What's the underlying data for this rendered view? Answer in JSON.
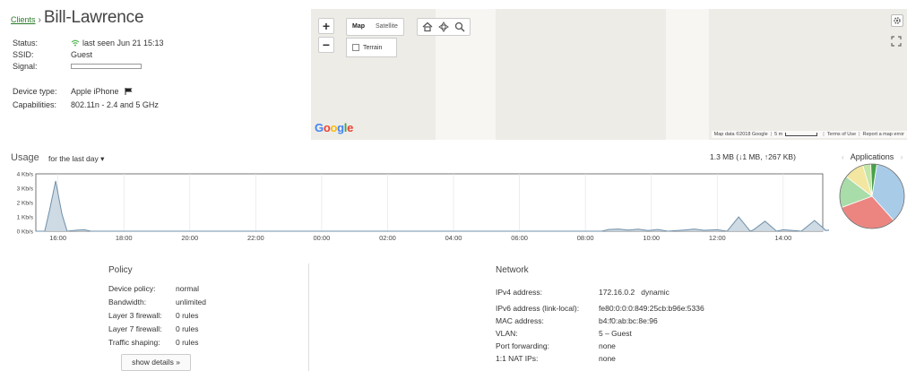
{
  "header": {
    "breadcrumb_link": "Clients",
    "breadcrumb_sep": "›",
    "client_name": "Bill-Lawrence"
  },
  "client": {
    "status_label": "Status:",
    "status_value": "last seen Jun 21 15:13",
    "ssid_label": "SSID:",
    "ssid_value": "Guest",
    "signal_label": "Signal:",
    "device_type_label": "Device type:",
    "device_type_value": "Apple iPhone",
    "capabilities_label": "Capabilities:",
    "capabilities_value": "802.11n - 2.4 and 5 GHz"
  },
  "map": {
    "zoom_in": "+",
    "zoom_out": "−",
    "type_map": "Map",
    "type_satellite": "Satellite",
    "terrain": "Terrain",
    "google_g1": "G",
    "google_o1": "o",
    "google_o2": "o",
    "google_g2": "g",
    "google_l": "l",
    "google_e": "e",
    "attribution": "Map data ©2018 Google",
    "scale": "5 m",
    "terms": "Terms of Use",
    "report": "Report a map error"
  },
  "usage": {
    "title": "Usage",
    "range": "for the last day ▾",
    "total": "1.3 MB (↓1 MB, ↑267 KB)",
    "apps_prev": "‹",
    "apps_label": "Applications",
    "apps_next": "›"
  },
  "chart_data": {
    "type": "area",
    "x_ticks": [
      "16:00",
      "18:00",
      "20:00",
      "22:00",
      "00:00",
      "02:00",
      "04:00",
      "06:00",
      "08:00",
      "10:00",
      "12:00",
      "14:00"
    ],
    "y_ticks": [
      "0 Kb/s",
      "1 Kb/s",
      "2 Kb/s",
      "3 Kb/s",
      "4 Kb/s"
    ],
    "ylim": [
      0,
      4
    ],
    "x_start_hour": 15.33,
    "x_end_hour": 39.2,
    "series": [
      {
        "color": "#6f8fa8",
        "points": [
          [
            15.33,
            0
          ],
          [
            15.6,
            0
          ],
          [
            15.75,
            1.5
          ],
          [
            15.93,
            3.5
          ],
          [
            16.12,
            1.2
          ],
          [
            16.28,
            0
          ],
          [
            16.6,
            0.08
          ],
          [
            16.8,
            0.1
          ],
          [
            17.0,
            0
          ],
          [
            32.5,
            0
          ],
          [
            32.7,
            0.12
          ],
          [
            33.0,
            0.15
          ],
          [
            33.3,
            0.08
          ],
          [
            33.6,
            0.14
          ],
          [
            33.9,
            0.05
          ],
          [
            34.2,
            0.12
          ],
          [
            34.5,
            0
          ],
          [
            35.0,
            0.08
          ],
          [
            35.3,
            0.15
          ],
          [
            35.6,
            0.06
          ],
          [
            36.0,
            0.1
          ],
          [
            36.3,
            0
          ],
          [
            36.65,
            1.0
          ],
          [
            37.0,
            0
          ],
          [
            37.1,
            0.1
          ],
          [
            37.45,
            0.7
          ],
          [
            37.8,
            0
          ],
          [
            38.0,
            0.1
          ],
          [
            38.3,
            0.05
          ],
          [
            38.55,
            0
          ],
          [
            38.95,
            0.75
          ],
          [
            39.3,
            0.05
          ],
          [
            39.55,
            0.15
          ],
          [
            39.9,
            0.95
          ],
          [
            40.2,
            0
          ]
        ]
      }
    ]
  },
  "pie_data": {
    "type": "pie",
    "slices": [
      {
        "value": 36,
        "color": "#a8cbe8"
      },
      {
        "value": 31,
        "color": "#ec8480"
      },
      {
        "value": 16,
        "color": "#a8dca8"
      },
      {
        "value": 10,
        "color": "#f2e6a0"
      },
      {
        "value": 4,
        "color": "#c4e6a6"
      },
      {
        "value": 3,
        "color": "#4aa04a"
      }
    ]
  },
  "policy": {
    "title": "Policy",
    "device_policy_label": "Device policy:",
    "device_policy_value": "normal",
    "bandwidth_label": "Bandwidth:",
    "bandwidth_value": "unlimited",
    "l3_label": "Layer 3 firewall:",
    "l3_value": "0 rules",
    "l7_label": "Layer 7 firewall:",
    "l7_value": "0 rules",
    "shaping_label": "Traffic shaping:",
    "shaping_value": "0 rules",
    "show_details": "show details »"
  },
  "network": {
    "title": "Network",
    "ipv4_label": "IPv4 address:",
    "ipv4_value": "172.16.0.2   dynamic",
    "ipv6_label": "IPv6 address (link-local):",
    "ipv6_value": "fe80:0:0:0:849:25cb:b96e:5336",
    "mac_label": "MAC address:",
    "mac_value": "b4:f0:ab:bc:8e:96",
    "vlan_label": "VLAN:",
    "vlan_value": "5 – Guest",
    "pf_label": "Port forwarding:",
    "pf_value": "none",
    "nat_label": "1:1 NAT IPs:",
    "nat_value": "none"
  }
}
